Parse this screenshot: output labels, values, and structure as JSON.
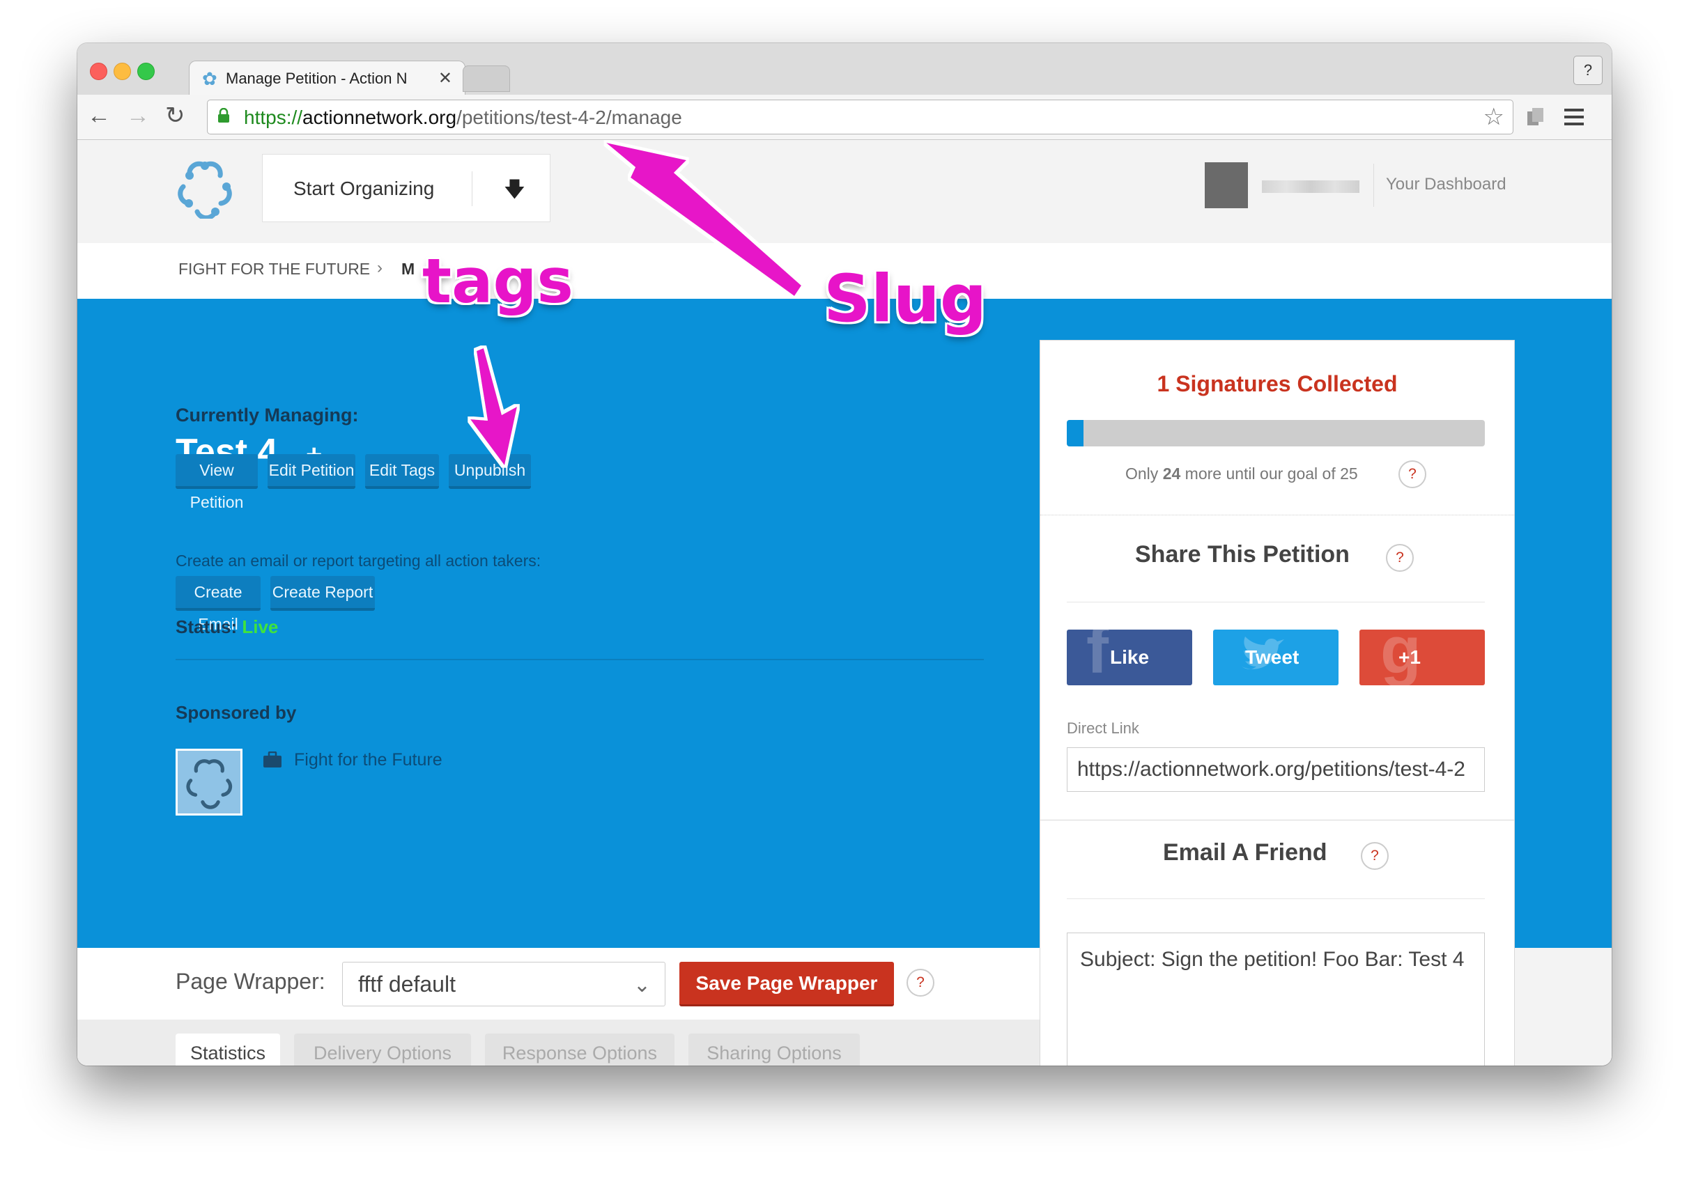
{
  "browser": {
    "tab_title": "Manage Petition - Action N",
    "help_label": "?",
    "url_scheme": "https://",
    "url_host": "actionnetwork.org",
    "url_path": "/petitions/test-4-2/manage"
  },
  "header": {
    "start_organizing": "Start Organizing",
    "dashboard_link": "Your Dashboard"
  },
  "breadcrumb": {
    "org": "FIGHT FOR THE FUTURE",
    "separator": "›",
    "current": "M"
  },
  "hero": {
    "managing_label": "Currently Managing:",
    "petition_name": "Test 4",
    "plus": "+",
    "buttons": [
      "View Petition",
      "Edit Petition",
      "Edit Tags",
      "Unpublish"
    ],
    "email_target_text": "Create an email or report targeting all action takers:",
    "action_buttons": [
      "Create Email",
      "Create Report"
    ],
    "status_label": "Status:",
    "status_value": "Live",
    "sponsored_label": "Sponsored by",
    "sponsor_name": "Fight for the Future"
  },
  "side_card": {
    "signatures_title": "1 Signatures Collected",
    "progress": 0.04,
    "goal_prefix": "Only ",
    "goal_remaining": "24",
    "goal_suffix": " more until our goal of 25",
    "share_title": "Share This Petition",
    "social": {
      "like": "Like",
      "tweet": "Tweet",
      "plus_one": "+1"
    },
    "direct_link_label": "Direct Link",
    "direct_link_value": "https://actionnetwork.org/petitions/test-4-2",
    "email_friend_title": "Email A Friend",
    "email_subject": "Subject: Sign the petition! Foo Bar: Test 4",
    "help": "?"
  },
  "wrapper": {
    "label": "Page Wrapper:",
    "selected": "fftf default",
    "save_button": "Save Page Wrapper"
  },
  "tabs": [
    "Statistics",
    "Delivery Options",
    "Response Options",
    "Sharing Options"
  ],
  "annotations": {
    "tags": "tags",
    "slug": "Slug"
  },
  "colors": {
    "hero": "#0a91d9",
    "accent_red": "#c9331f",
    "annotation": "#e714c8",
    "facebook": "#3b5998",
    "twitter": "#1da1e6",
    "google": "#dd4b39"
  },
  "icons": [
    "back-arrow-icon",
    "forward-arrow-icon",
    "reload-icon",
    "lock-icon",
    "star-icon",
    "extension-icon",
    "menu-icon",
    "down-arrow-icon",
    "chevron-down-icon",
    "briefcase-icon",
    "question-icon"
  ]
}
